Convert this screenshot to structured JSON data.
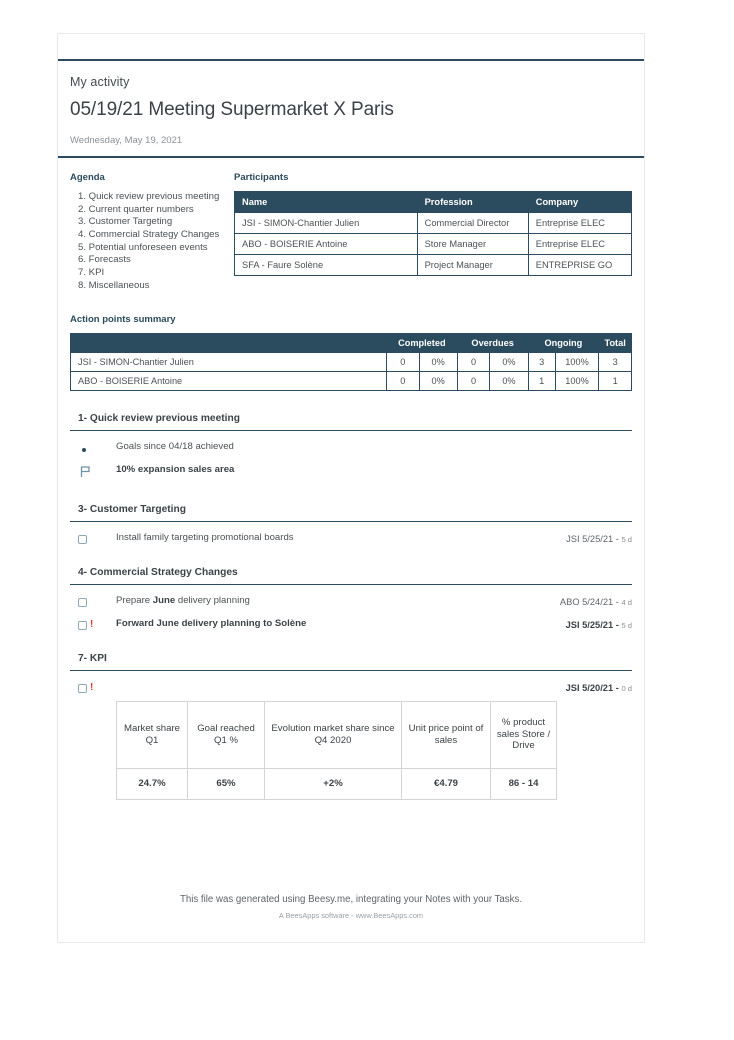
{
  "header": {
    "kicker": "My activity",
    "title": "05/19/21 Meeting Supermarket X Paris",
    "date": "Wednesday, May 19, 2021"
  },
  "agenda": {
    "label": "Agenda",
    "items": [
      "1. Quick review previous meeting",
      "2. Current quarter numbers",
      "3. Customer Targeting",
      "4. Commercial Strategy Changes",
      "5. Potential unforeseen events",
      "6. Forecasts",
      "7. KPI",
      "8. Miscellaneous"
    ]
  },
  "participants": {
    "label": "Participants",
    "columns": [
      "Name",
      "Profession",
      "Company"
    ],
    "rows": [
      [
        "JSI - SIMON-Chantier Julien",
        "Commercial Director",
        "Entreprise ELEC"
      ],
      [
        "ABO - BOISERIE Antoine",
        "Store Manager",
        "Entreprise ELEC"
      ],
      [
        "SFA - Faure Solène",
        "Project Manager",
        "ENTREPRISE GO"
      ]
    ]
  },
  "action_points": {
    "label": "Action points summary",
    "columns": [
      "",
      "Completed",
      "Overdues",
      "Ongoing",
      "Total"
    ],
    "rows": [
      {
        "name": "JSI - SIMON-Chantier Julien",
        "completed_n": "0",
        "completed_pct": "0%",
        "overdues_n": "0",
        "overdues_pct": "0%",
        "ongoing_n": "3",
        "ongoing_pct": "100%",
        "total": "3"
      },
      {
        "name": "ABO - BOISERIE Antoine",
        "completed_n": "0",
        "completed_pct": "0%",
        "overdues_n": "0",
        "overdues_pct": "0%",
        "ongoing_n": "1",
        "ongoing_pct": "100%",
        "total": "1"
      }
    ]
  },
  "sections": {
    "s1": {
      "heading": "1- Quick review previous meeting",
      "items": [
        {
          "marker": "bullet",
          "text": "Goals since 04/18 achieved",
          "bold": false,
          "meta": "",
          "duration": ""
        },
        {
          "marker": "flag",
          "text": "10% expansion sales area",
          "bold": true,
          "meta": "",
          "duration": ""
        }
      ]
    },
    "s3": {
      "heading": "3- Customer Targeting",
      "items": [
        {
          "marker": "checkbox",
          "text": "Install family targeting promotional boards",
          "bold": false,
          "meta": "JSI 5/25/21 -",
          "duration": "5 d"
        }
      ]
    },
    "s4": {
      "heading": "4- Commercial Strategy Changes",
      "items": [
        {
          "marker": "checkbox",
          "text_pre": "Prepare ",
          "text_bold": "June",
          "text_post": " delivery planning",
          "bold": false,
          "meta": "ABO 5/24/21 -",
          "duration": "4 d"
        },
        {
          "marker": "checkbox-alert",
          "text": "Forward June delivery planning to Solène",
          "bold": true,
          "meta": "JSI 5/25/21 -",
          "duration": "5 d"
        }
      ]
    },
    "s7": {
      "heading": "7- KPI",
      "kpi_item": {
        "marker": "checkbox-alert",
        "meta": "JSI 5/20/21 -",
        "duration": "0 d"
      }
    }
  },
  "kpi_table": {
    "columns": [
      "Market share Q1",
      "Goal reached Q1 %",
      "Evolution market share since Q4 2020",
      "Unit price point of sales",
      "% product sales Store / Drive"
    ],
    "values": [
      "24.7%",
      "65%",
      "+2%",
      "€4.79",
      "86 - 14"
    ]
  },
  "footer": {
    "main": "This file was generated using Beesy.me, integrating your Notes with your Tasks.",
    "sub": "A BeesApps software - www.BeesApps.com"
  },
  "colors": {
    "accent": "#2b4c5e",
    "red": "#e8352a",
    "green": "#7fbb2f",
    "orange": "#ee8c2b"
  }
}
